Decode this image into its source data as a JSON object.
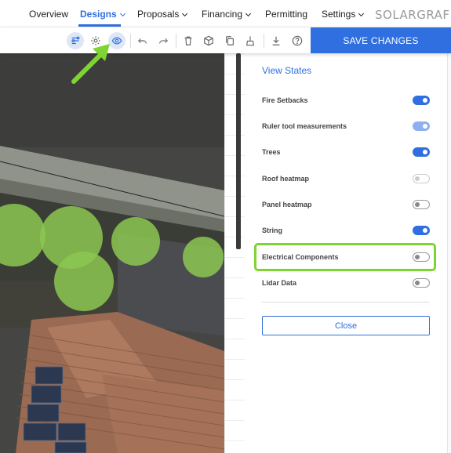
{
  "nav": {
    "items": [
      {
        "label": "Overview",
        "has_menu": false,
        "active": false
      },
      {
        "label": "Designs",
        "has_menu": true,
        "active": true
      },
      {
        "label": "Proposals",
        "has_menu": true,
        "active": false
      },
      {
        "label": "Financing",
        "has_menu": true,
        "active": false
      },
      {
        "label": "Permitting",
        "has_menu": false,
        "active": false
      },
      {
        "label": "Settings",
        "has_menu": true,
        "active": false
      }
    ],
    "logo": "SOLARGRAF"
  },
  "toolbar": {
    "icons": [
      "drawing-tools-icon",
      "settings-gear-icon",
      "view-eye-icon",
      "undo-icon",
      "redo-icon",
      "delete-trash-icon",
      "3d-box-icon",
      "copy-icon",
      "clean-icon",
      "download-icon",
      "help-icon"
    ],
    "save_label": "SAVE CHANGES"
  },
  "panel": {
    "title": "View States",
    "rows": [
      {
        "label": "Fire Setbacks",
        "state": "on"
      },
      {
        "label": "Ruler tool measurements",
        "state": "on-light"
      },
      {
        "label": "Trees",
        "state": "on"
      },
      {
        "label": "Roof heatmap",
        "state": "disabled"
      },
      {
        "label": "Panel heatmap",
        "state": "off"
      },
      {
        "label": "String",
        "state": "on"
      },
      {
        "label": "Electrical Components",
        "state": "off"
      },
      {
        "label": "Lidar Data",
        "state": "off"
      }
    ],
    "close_label": "Close"
  },
  "colors": {
    "accent": "#2f6fe0",
    "highlight_box": "#7ed431",
    "tree_marker": "#8cc751"
  }
}
